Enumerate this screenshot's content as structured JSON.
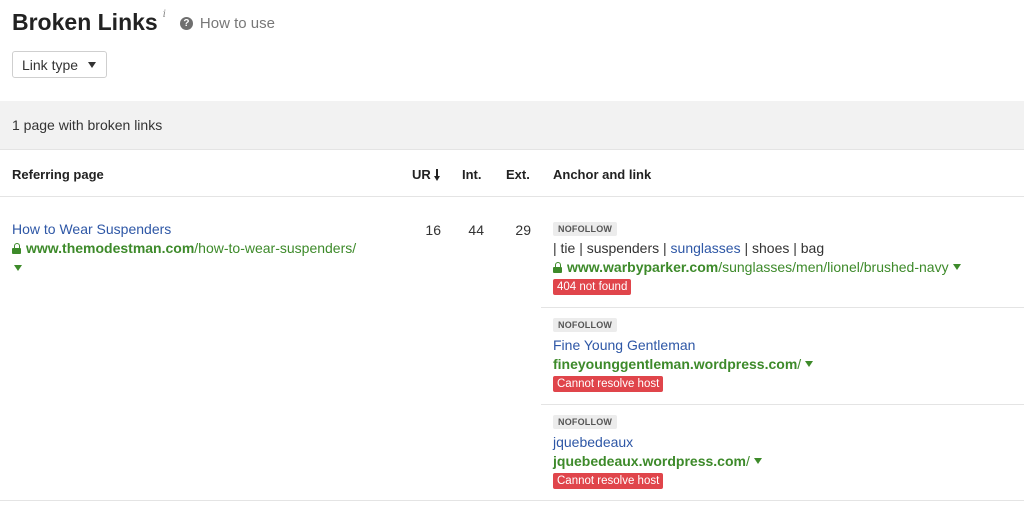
{
  "header": {
    "title": "Broken Links",
    "info_mark": "i",
    "how_to_use": "How to use"
  },
  "filter": {
    "link_type_label": "Link type"
  },
  "summary": {
    "text": "1 page with broken links"
  },
  "table": {
    "columns": {
      "referring_page": "Referring page",
      "ur": "UR",
      "int": "Int.",
      "ext": "Ext.",
      "anchor_and_link": "Anchor and link"
    },
    "rows": [
      {
        "referring_title": "How to Wear Suspenders",
        "referring_domain": "www.themodestman.com",
        "referring_path": "/how-to-wear-suspenders/",
        "ur": "16",
        "int": "44",
        "ext": "29",
        "anchors": [
          {
            "tag": "NOFOLLOW",
            "anchor_before": "| tie | suspenders | ",
            "anchor_link": "sunglasses",
            "anchor_after": " | shoes | bag",
            "url_domain": "www.warbyparker.com",
            "url_path": "/sunglasses/men/lionel/brushed-navy",
            "secure": true,
            "error": "404 not found"
          },
          {
            "tag": "NOFOLLOW",
            "anchor_link": "Fine Young Gentleman",
            "url_domain": "fineyounggentleman.wordpress.com",
            "url_path": "/",
            "secure": false,
            "error": "Cannot resolve host"
          },
          {
            "tag": "NOFOLLOW",
            "anchor_link": "jquebedeaux",
            "url_domain": "jquebedeaux.wordpress.com",
            "url_path": "/",
            "secure": false,
            "error": "Cannot resolve host"
          }
        ]
      }
    ]
  },
  "colors": {
    "link_blue": "#2e57a6",
    "url_green": "#3d8a2a",
    "error_red": "#e0454b",
    "summary_bg": "#f2f2f2"
  },
  "icons": [
    "info-icon",
    "question-icon",
    "caret-down-icon",
    "sort-arrow-down-icon",
    "lock-icon",
    "dropdown-caret-icon"
  ]
}
